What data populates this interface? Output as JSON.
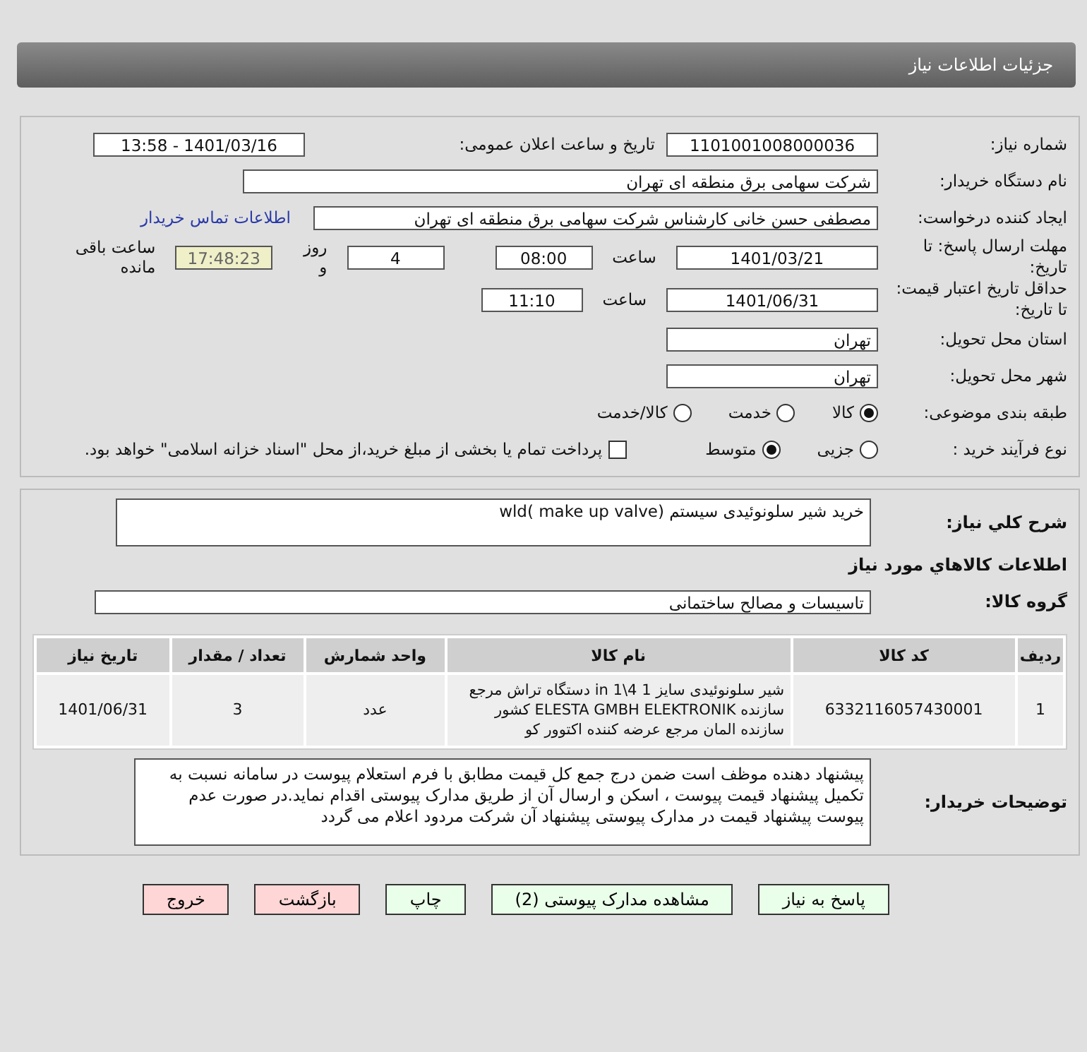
{
  "header": {
    "title": "جزئیات اطلاعات نیاز"
  },
  "need_number": {
    "label": "شماره نیاز:",
    "value": "1101001008000036"
  },
  "announce": {
    "label": "تاریخ و ساعت اعلان عمومی:",
    "value": "1401/03/16 - 13:58"
  },
  "buyer_org": {
    "label": "نام دستگاه خریدار:",
    "value": "شرکت سهامی برق منطقه ای تهران"
  },
  "requester": {
    "label": "ایجاد کننده درخواست:",
    "value": "مصطفی حسن خانی  کارشناس شرکت سهامی برق منطقه ای تهران",
    "link": "اطلاعات تماس خریدار"
  },
  "deadline": {
    "label": "مهلت ارسال پاسخ: تا تاریخ:",
    "date": "1401/03/21",
    "time_label": "ساعت",
    "time": "08:00",
    "days": "4",
    "days_label": "روز و",
    "remaining": "17:48:23",
    "remaining_label": "ساعت باقی مانده"
  },
  "validity": {
    "label": "حداقل تاریخ اعتبار قیمت: تا تاریخ:",
    "date": "1401/06/31",
    "time_label": "ساعت",
    "time": "11:10"
  },
  "province": {
    "label": "استان محل تحویل:",
    "value": "تهران"
  },
  "city": {
    "label": "شهر محل تحویل:",
    "value": "تهران"
  },
  "category": {
    "label": "طبقه بندی موضوعی:",
    "options": [
      {
        "label": "کالا",
        "selected": true
      },
      {
        "label": "خدمت",
        "selected": false
      },
      {
        "label": "کالا/خدمت",
        "selected": false
      }
    ]
  },
  "process": {
    "label": "نوع فرآیند خرید :",
    "options": [
      {
        "label": "جزیی",
        "selected": false
      },
      {
        "label": "متوسط",
        "selected": true
      }
    ],
    "payment": {
      "label": "پرداخت تمام یا بخشی از مبلغ خرید،از محل \"اسناد خزانه اسلامی\" خواهد بود.",
      "checked": false
    }
  },
  "summary": {
    "label": "شرح كلي نياز:",
    "value": "خرید شیر سلونوئیدی سیستم wld( make up valve)"
  },
  "goods_heading": "اطلاعات كالاهاي مورد نياز",
  "goods_group": {
    "label": "گروه كالا:",
    "value": "تاسیسات و مصالح ساختمانی"
  },
  "table": {
    "columns": [
      "ردیف",
      "کد کالا",
      "نام کالا",
      "واحد شمارش",
      "تعداد / مقدار",
      "تاریخ نیاز"
    ],
    "rows": [
      [
        "1",
        "6332116057430001",
        "شیر سلونوئیدی سایز 1 4\\1 in دستگاه تراش مرجع سازنده ELESTA GMBH ELEKTRONIK کشور سازنده المان مرجع عرضه کننده اکتوور کو",
        "عدد",
        "3",
        "1401/06/31"
      ]
    ]
  },
  "buyer_notes": {
    "label": "توضیحات خریدار:",
    "value": "پیشنهاد دهنده موظف است ضمن درج جمع کل قیمت مطابق با فرم استعلام پیوست در سامانه نسبت به تکمیل پیشنهاد قیمت پیوست ، اسکن و ارسال آن از طریق مدارک پیوستی اقدام نماید.در صورت عدم پیوست پیشنهاد قیمت در مدارک پیوستی پیشنهاد آن شرکت مردود اعلام می گردد"
  },
  "buttons": [
    {
      "label": "پاسخ به نیاز",
      "kind": "normal"
    },
    {
      "label": "مشاهده مدارک پیوستی (2)",
      "kind": "normal"
    },
    {
      "label": "چاپ",
      "kind": "normal"
    },
    {
      "label": "بازگشت",
      "kind": "danger"
    },
    {
      "label": "خروج",
      "kind": "danger"
    }
  ]
}
